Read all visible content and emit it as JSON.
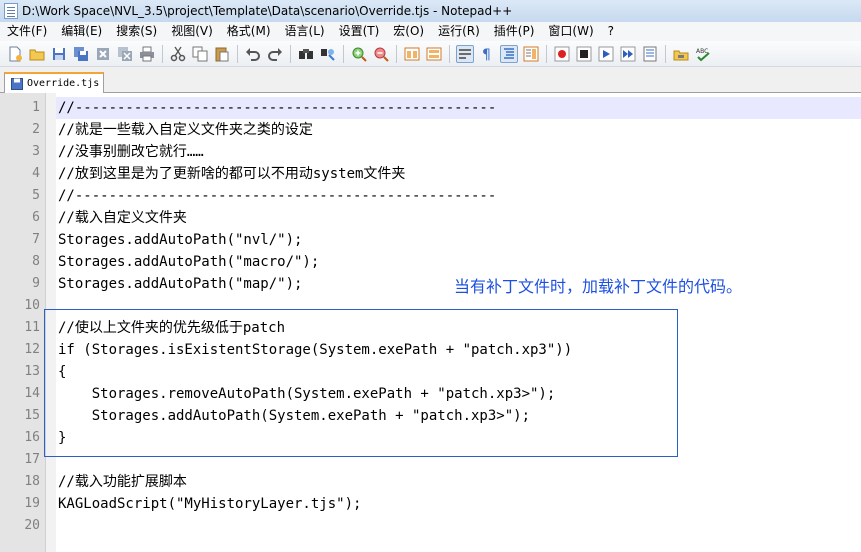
{
  "window": {
    "title": "D:\\Work Space\\NVL_3.5\\project\\Template\\Data\\scenario\\Override.tjs - Notepad++"
  },
  "menu": [
    "文件(F)",
    "编辑(E)",
    "搜索(S)",
    "视图(V)",
    "格式(M)",
    "语言(L)",
    "设置(T)",
    "宏(O)",
    "运行(R)",
    "插件(P)",
    "窗口(W)",
    "?"
  ],
  "toolbar": {
    "icons": [
      "new-file-icon",
      "open-file-icon",
      "save-icon",
      "save-all-icon",
      "close-icon",
      "close-all-icon",
      "print-icon",
      "cut-icon",
      "copy-icon",
      "paste-icon",
      "undo-icon",
      "redo-icon",
      "find-icon",
      "replace-icon",
      "zoom-in-icon",
      "zoom-out-icon",
      "sync-vertical-icon",
      "sync-horizontal-icon",
      "word-wrap-icon",
      "show-all-chars-icon",
      "indent-guide-icon",
      "doc-map-icon",
      "record-macro-icon",
      "stop-record-icon",
      "play-macro-icon",
      "run-macro-multiple-icon",
      "save-macro-icon",
      "launch-browser-icon",
      "spell-check-icon"
    ]
  },
  "tab": {
    "label": "Override.tjs"
  },
  "editor": {
    "lines": [
      {
        "num": "1",
        "text": "//--------------------------------------------------"
      },
      {
        "num": "2",
        "text": "//就是一些载入自定义文件夹之类的设定"
      },
      {
        "num": "3",
        "text": "//没事别删改它就行……"
      },
      {
        "num": "4",
        "text": "//放到这里是为了更新啥的都可以不用动system文件夹"
      },
      {
        "num": "5",
        "text": "//--------------------------------------------------"
      },
      {
        "num": "6",
        "text": "//载入自定义文件夹"
      },
      {
        "num": "7",
        "text": "Storages.addAutoPath(\"nvl/\");"
      },
      {
        "num": "8",
        "text": "Storages.addAutoPath(\"macro/\");"
      },
      {
        "num": "9",
        "text": "Storages.addAutoPath(\"map/\");"
      },
      {
        "num": "10",
        "text": ""
      },
      {
        "num": "11",
        "text": "//使以上文件夹的优先级低于patch"
      },
      {
        "num": "12",
        "text": "if (Storages.isExistentStorage(System.exePath + \"patch.xp3\"))"
      },
      {
        "num": "13",
        "text": "{"
      },
      {
        "num": "14",
        "text": "    Storages.removeAutoPath(System.exePath + \"patch.xp3>\");"
      },
      {
        "num": "15",
        "text": "    Storages.addAutoPath(System.exePath + \"patch.xp3>\");"
      },
      {
        "num": "16",
        "text": "}"
      },
      {
        "num": "17",
        "text": ""
      },
      {
        "num": "18",
        "text": "//载入功能扩展脚本"
      },
      {
        "num": "19",
        "text": "KAGLoadScript(\"MyHistoryLayer.tjs\");"
      },
      {
        "num": "20",
        "text": ""
      }
    ]
  },
  "annotation": {
    "text": "当有补丁文件时，加载补丁文件的代码。",
    "color": "#1e50e0"
  }
}
